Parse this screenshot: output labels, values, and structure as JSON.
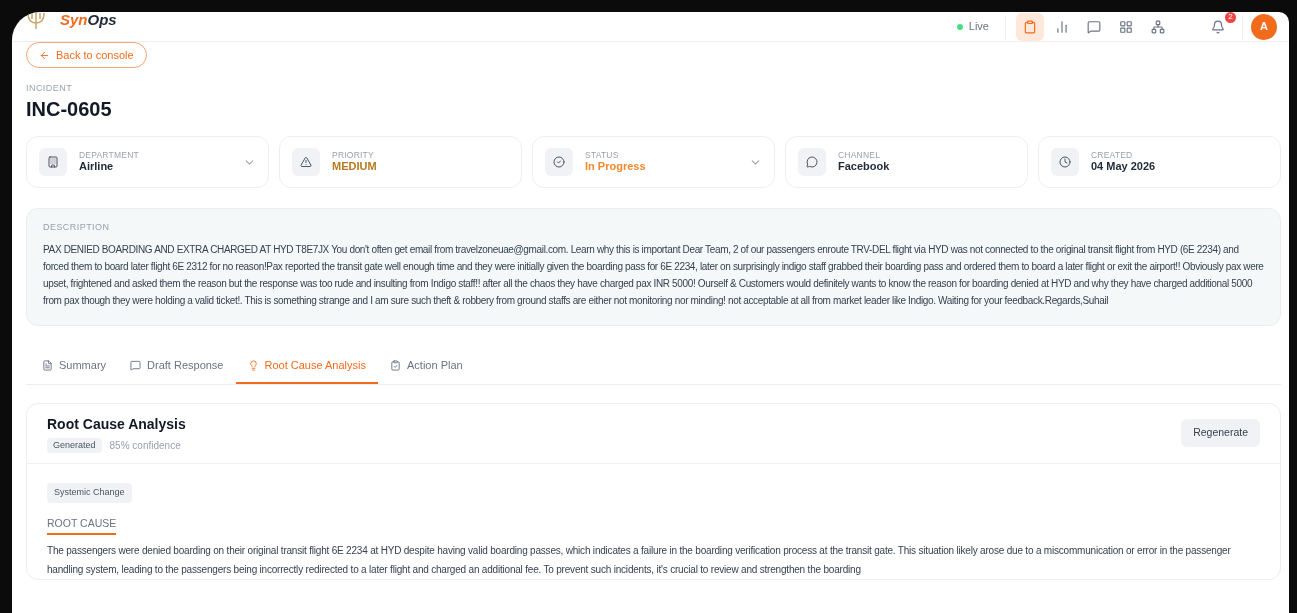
{
  "header": {
    "brand": {
      "first": "Syn",
      "second": "Ops"
    },
    "live": {
      "label": "Live",
      "on": true
    },
    "nav": [
      {
        "selected": true
      },
      {
        "selected": false
      },
      {
        "selected": false
      },
      {
        "selected": false
      },
      {
        "selected": false
      }
    ],
    "notifications": {
      "badge": "2"
    },
    "avatar": "A"
  },
  "back_button": "Back to console",
  "incident": {
    "label": "INCIDENT",
    "id": "INC-0605"
  },
  "fields": [
    {
      "label": "DEPARTMENT",
      "value": "Airline",
      "color": "#1f2937",
      "dropdown": true
    },
    {
      "label": "PRIORITY",
      "value": "MEDIUM",
      "color": "#b7791f",
      "dropdown": false
    },
    {
      "label": "STATUS",
      "value": "In Progress",
      "color": "#f0892e",
      "dropdown": true
    },
    {
      "label": "CHANNEL",
      "value": "Facebook",
      "color": "#1f2937",
      "dropdown": false
    },
    {
      "label": "CREATED",
      "value": "04 May 2026",
      "color": "#1f2937",
      "dropdown": false
    }
  ],
  "description": {
    "label": "DESCRIPTION",
    "text": "PAX DENIED BOARDING AND EXTRA CHARGED AT HYD T8E7JX You don't often get email from travelzoneuae@gmail.com. Learn why this is important Dear Team, 2 of our passengers enroute TRV-DEL flight via HYD was not connected to the original transit flight from HYD (6E 2234) and forced them to board later flight 6E 2312 for no reason!Pax reported the transit gate well enough time and they were initially given the boarding pass for 6E 2234, later on surprisingly indigo staff grabbed their boarding pass and ordered them to board a later flight or exit the airport!! Obviously pax were upset, frightened and asked them the reason but the response was too rude and insulting from Indigo staff!! after all the chaos they have charged pax INR 5000! Ourself & Customers would definitely wants to know the reason for boarding denied at HYD and why they have charged additional 5000 from pax though they were holding a valid ticket!. This is something strange and I am sure such theft & robbery from ground staffs are either not monitoring nor minding! not acceptable at all from market leader like Indigo. Waiting for your feedback.Regards,Suhail"
  },
  "tabs": [
    {
      "label": "Summary",
      "selected": false
    },
    {
      "label": "Draft Response",
      "selected": false
    },
    {
      "label": "Root Cause Analysis",
      "selected": true
    },
    {
      "label": "Action Plan",
      "selected": false
    }
  ],
  "analysis": {
    "title": "Root Cause Analysis",
    "status": "Generated",
    "confidence": "85% confidence",
    "button": "Regenerate",
    "tag": "Systemic Change",
    "section": "ROOT CAUSE",
    "text": "The passengers were denied boarding on their original transit flight 6E 2234 at HYD despite having valid boarding passes, which indicates a failure in the boarding verification process at the transit gate. This situation likely arose due to a miscommunication or error in the passenger handling system, leading to the passengers being incorrectly redirected to a later flight and charged an additional fee. To prevent such incidents, it's crucial to review and strengthen the boarding"
  }
}
